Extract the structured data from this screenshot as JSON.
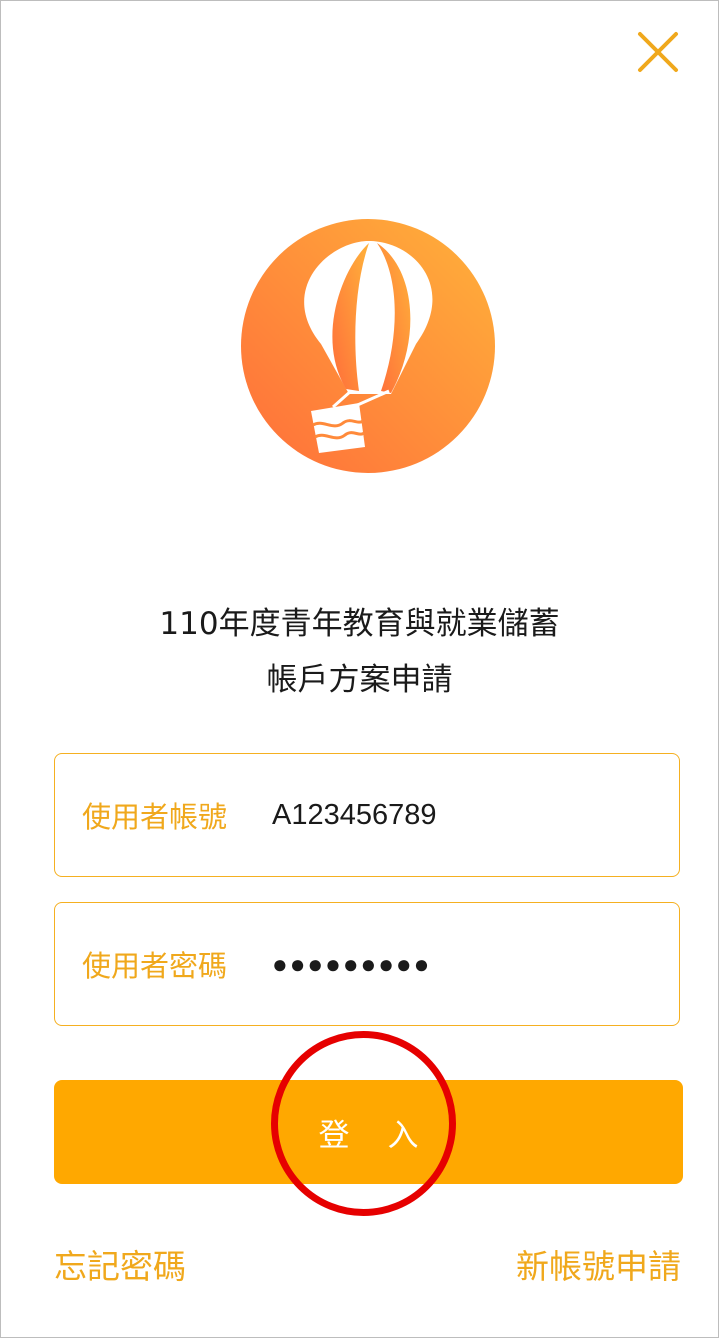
{
  "title": {
    "line1": "110年度青年教育與就業儲蓄",
    "line2": "帳戶方案申請"
  },
  "form": {
    "username_label": "使用者帳號",
    "username_value": "A123456789",
    "password_label": "使用者密碼",
    "password_value": "●●●●●●●●●"
  },
  "login_button_label": "登入",
  "links": {
    "forgot_password": "忘記密碼",
    "new_account": "新帳號申請"
  },
  "icons": {
    "close": "close-icon",
    "logo": "hot-air-balloon-logo"
  },
  "colors": {
    "accent": "#ffa800",
    "label": "#f0a81c",
    "field_border": "#f5b021",
    "logo_gradient_start": "#ff7a3d",
    "logo_gradient_end": "#ffb13a",
    "annotation": "#e60000"
  }
}
